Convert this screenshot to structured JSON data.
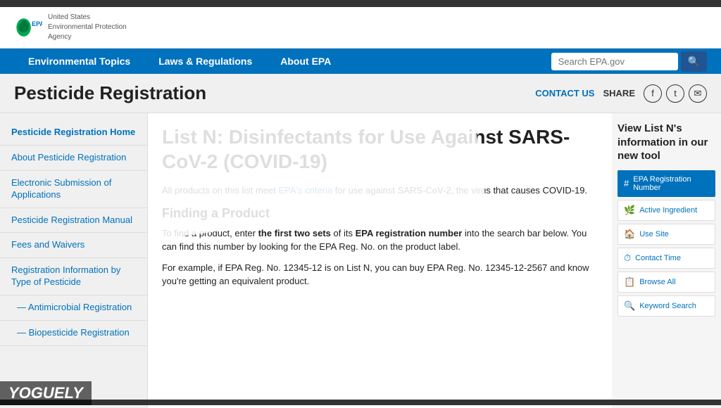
{
  "topBar": {},
  "header": {
    "logoAlt": "EPA Logo",
    "agencyLine1": "United States",
    "agencyLine2": "Environmental Protection",
    "agencyLine3": "Agency"
  },
  "nav": {
    "links": [
      {
        "label": "Environmental Topics",
        "id": "env-topics"
      },
      {
        "label": "Laws & Regulations",
        "id": "laws-regs"
      },
      {
        "label": "About EPA",
        "id": "about-epa"
      }
    ],
    "searchPlaceholder": "Search EPA.gov",
    "searchIconLabel": "🔍"
  },
  "pageHeader": {
    "title": "Pesticide Registration",
    "contactUs": "CONTACT US",
    "share": "SHARE"
  },
  "sidebar": {
    "items": [
      {
        "label": "Pesticide Registration Home",
        "id": "reg-home"
      },
      {
        "label": "About Pesticide Registration",
        "id": "about-reg"
      },
      {
        "label": "Electronic Submission of Applications",
        "id": "electronic-sub"
      },
      {
        "label": "Pesticide Registration Manual",
        "id": "reg-manual"
      },
      {
        "label": "Fees and Waivers",
        "id": "fees-waivers"
      },
      {
        "label": "Registration Information by Type of Pesticide",
        "id": "reg-info-type"
      },
      {
        "label": "— Antimicrobial Registration",
        "id": "antimicrobial",
        "sub": true
      },
      {
        "label": "— Biopesticide Registration",
        "id": "biopesticide",
        "sub": true
      }
    ]
  },
  "mainContent": {
    "heading": "List N: Disinfectants for Use Against SARS-CoV-2 (COVID-19)",
    "intro": "All products on this list meet EPA's criteria for use against SARS-CoV-2, the virus that causes COVID-19.",
    "epaCriteriaLinkText": "EPA's criteria",
    "findingHeading": "Finding a Product",
    "findingText1": "To find a product, enter the first two sets of its EPA registration number into the search bar below. You can find this number by looking for the EPA Reg. No. on the product label.",
    "findingText2": "For example, if EPA Reg. No. 12345-12 is on List N, you can buy EPA Reg. No. 12345-12-2567 and know you're getting an equivalent product."
  },
  "rightSidebar": {
    "title": "View List N's information in our new tool",
    "toolItems": [
      {
        "label": "EPA Registration Number",
        "icon": "#",
        "active": true
      },
      {
        "label": "Active Ingredient",
        "icon": "🌿"
      },
      {
        "label": "Use Site",
        "icon": "🏠"
      },
      {
        "label": "Contact Time",
        "icon": "⏱"
      },
      {
        "label": "Browse All",
        "icon": "📋"
      },
      {
        "label": "Keyword Search",
        "icon": "🔍"
      }
    ]
  },
  "watermark": "YOGUELY",
  "social": {
    "facebook": "f",
    "twitter": "t",
    "email": "✉"
  }
}
